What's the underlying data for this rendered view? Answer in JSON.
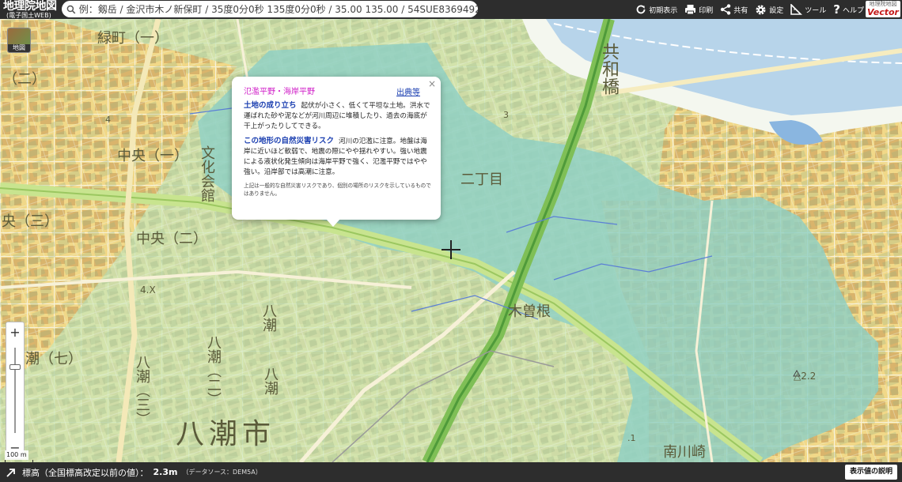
{
  "header": {
    "logo_main": "地理院地図",
    "logo_sub": "(電子国土WEB)",
    "search_text": "例：剱岳 / 金沢市木ノ新保町 / 35度0分0秒 135度0分0秒 / 35.00 135.00 / 54SUE83694920",
    "tools": {
      "home": "初期表示",
      "print": "印刷",
      "share": "共有",
      "settings": "設定",
      "tools": "ツール",
      "help": "ヘルプ"
    },
    "vector_top": "地理院地図",
    "vector_main": "Vector"
  },
  "map": {
    "basemap_label": "地図",
    "scale_text": "100 m",
    "zoom_level": 0.22,
    "labels": {
      "midoricho": "緑町（一）",
      "ni": "（二）",
      "chuo_1": "中央（一）",
      "chuo_2": "中央（二）",
      "san": "央（三）",
      "bunkakaikan": "文化会館",
      "nichome": "二丁目",
      "kisone": "木曽根",
      "kyowabashi": "共和橋",
      "yashio_1": "八潮",
      "yashio_2": "八潮（二）",
      "yashio_3": "八潮（三）",
      "yashio_7": "潮（七）",
      "yashio_left": "八潮",
      "yashio_city": "八潮市",
      "minamikawasaki": "南川崎",
      "elev_22": "△2.2",
      "num_4": "4",
      "num_4x": "4.X",
      "num_1": ".1",
      "num_3": "3"
    }
  },
  "popup": {
    "title": "氾濫平野・海岸平野",
    "source_link": "出典等",
    "close": "×",
    "p1_heading": "土地の成り立ち",
    "p1_body": "起伏が小さく、低くて平坦な土地。洪水で運ばれた砂や泥などが河川周辺に堆積したり、過去の海底が干上がったりしてできる。",
    "p2_heading": "この地形の自然災害リスク",
    "p2_body": "河川の氾濫に注意。地盤は海岸に近いほど軟弱で、地震の際にやや揺れやすい。強い地震による液状化発生傾向は海岸平野で強く、氾濫平野ではやや強い。沿岸部では高潮に注意。",
    "note": "上記は一般的な自然災害リスクであり、個別の場所のリスクを示しているものではありません。"
  },
  "footer": {
    "label": "標高（全国標高改定以前の値）：",
    "value": "2.3m",
    "source": "（データソース：DEM5A）",
    "button": "表示値の説明"
  }
}
